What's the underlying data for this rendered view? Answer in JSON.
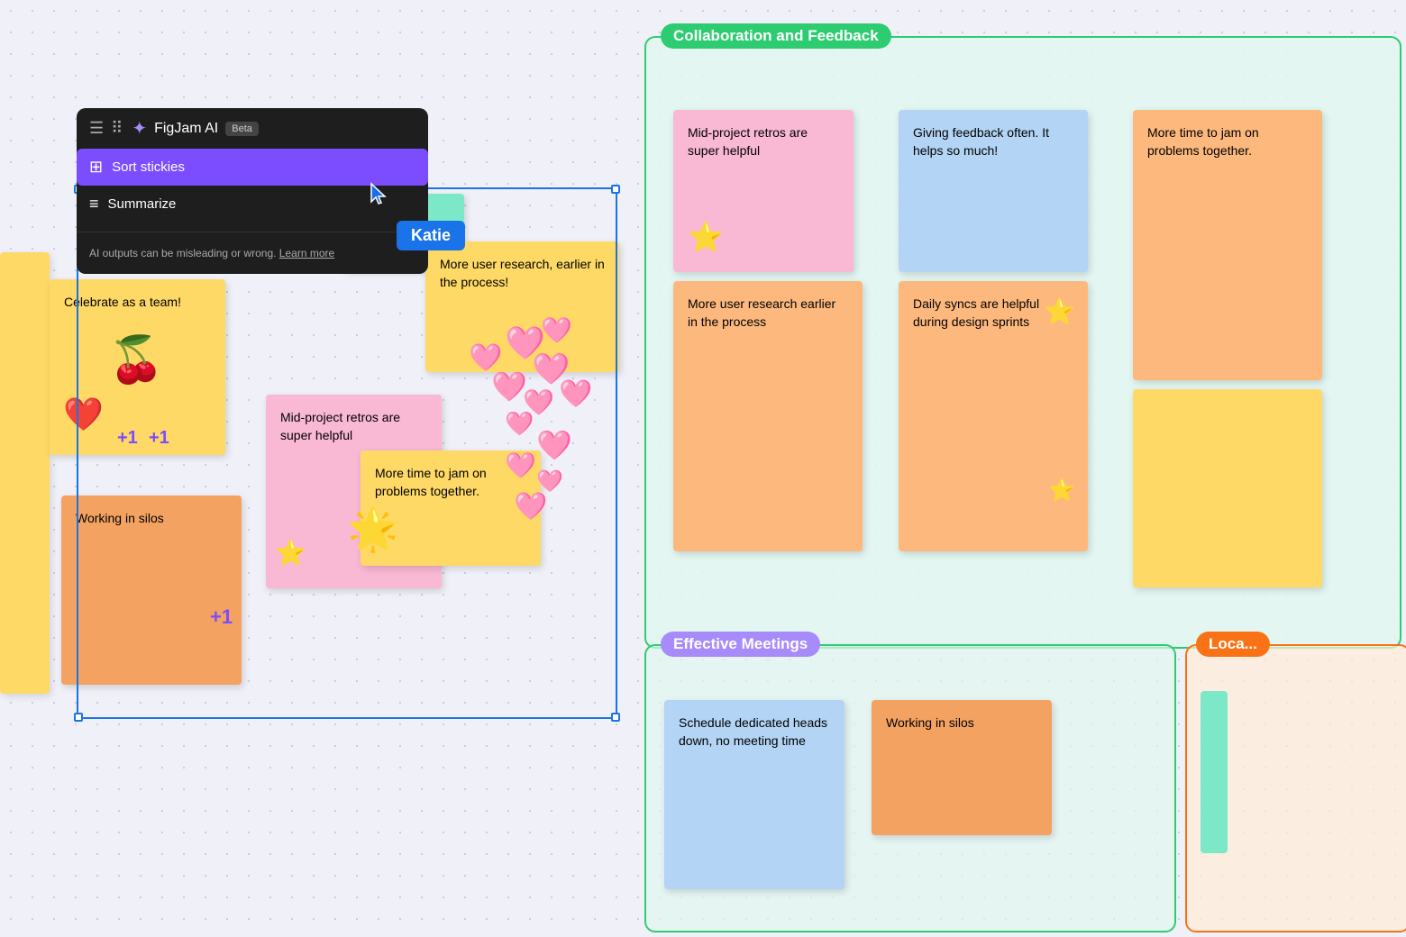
{
  "toolbar": {
    "ai_title": "FigJam AI",
    "beta_label": "Beta",
    "sort_stickies": "Sort stickies",
    "summarize": "Summarize",
    "disclaimer": "AI outputs can be misleading or wrong.",
    "learn_more": "Learn more"
  },
  "cursor_label": "Katie",
  "selection_box": {
    "visible": true
  },
  "sections": {
    "collab": {
      "title": "Collaboration and Feedback",
      "stickies": [
        {
          "text": "Mid-project retros are super helpful",
          "color": "pink"
        },
        {
          "text": "Giving feedback often. It helps so much!",
          "color": "blue"
        },
        {
          "text": "More time to jam on problems together.",
          "color": "orange"
        },
        {
          "text": "Daily syncs are helpful during design sprints",
          "color": "orange"
        },
        {
          "text": "More user research earlier in the process",
          "color": "orange"
        }
      ]
    },
    "meetings": {
      "title": "Effective Meetings",
      "stickies": [
        {
          "text": "Schedule dedicated heads down, no meeting time",
          "color": "blue"
        },
        {
          "text": "Working in silos",
          "color": "salmon"
        }
      ]
    }
  },
  "left_stickies": [
    {
      "text": "Celebrate as a team!",
      "color": "yellow"
    },
    {
      "text": "Working in silos",
      "color": "salmon"
    },
    {
      "text": "Mid-project retros are super helpful",
      "color": "pink"
    },
    {
      "text": "More time to jam on problems together.",
      "color": "yellow"
    },
    {
      "text": "More user research, earlier in the process!",
      "color": "yellow"
    }
  ]
}
